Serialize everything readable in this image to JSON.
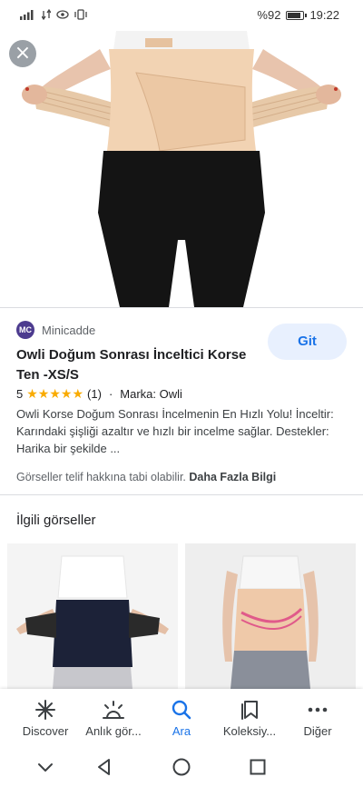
{
  "status_bar": {
    "left_icons": [
      "signal-icon",
      "data-icon",
      "eye-comfort-icon",
      "vibrate-icon"
    ],
    "battery": "%92",
    "battery_level": 0.92,
    "time": "19:22"
  },
  "hero": {
    "close_label": "×"
  },
  "product": {
    "source_logo": "MC",
    "source_name": "Minicadde",
    "visit_label": "Git",
    "title": "Owli Doğum Sonrası İnceltici Korse Ten -XS/S",
    "rating_value": "5",
    "rating_stars": 5,
    "review_count": "(1)",
    "separator": "·",
    "brand": "Marka: Owli",
    "description": "Owli Korse Doğum Sonrası İncelmenin En Hızlı Yolu! İnceltir: Karındaki şişliği azaltır ve hızlı bir incelme sağlar. Destekler: Harika bir şekilde ...",
    "copyright_text": "Görseller telif hakkına tabi olabilir.",
    "more_info": "Daha Fazla Bilgi"
  },
  "related": {
    "title": "İlgili görseller"
  },
  "bottom_nav": {
    "items": [
      {
        "label": "Discover",
        "icon": "asterisk-icon"
      },
      {
        "label": "Anlık gör...",
        "icon": "snapshot-icon"
      },
      {
        "label": "Ara",
        "icon": "search-icon"
      },
      {
        "label": "Koleksiy...",
        "icon": "collections-icon"
      },
      {
        "label": "Diğer",
        "icon": "more-icon"
      }
    ],
    "active_index": 2
  },
  "colors": {
    "accent": "#1a73e8",
    "star": "#f9ab00",
    "source_logo": "#4c3b8f"
  }
}
